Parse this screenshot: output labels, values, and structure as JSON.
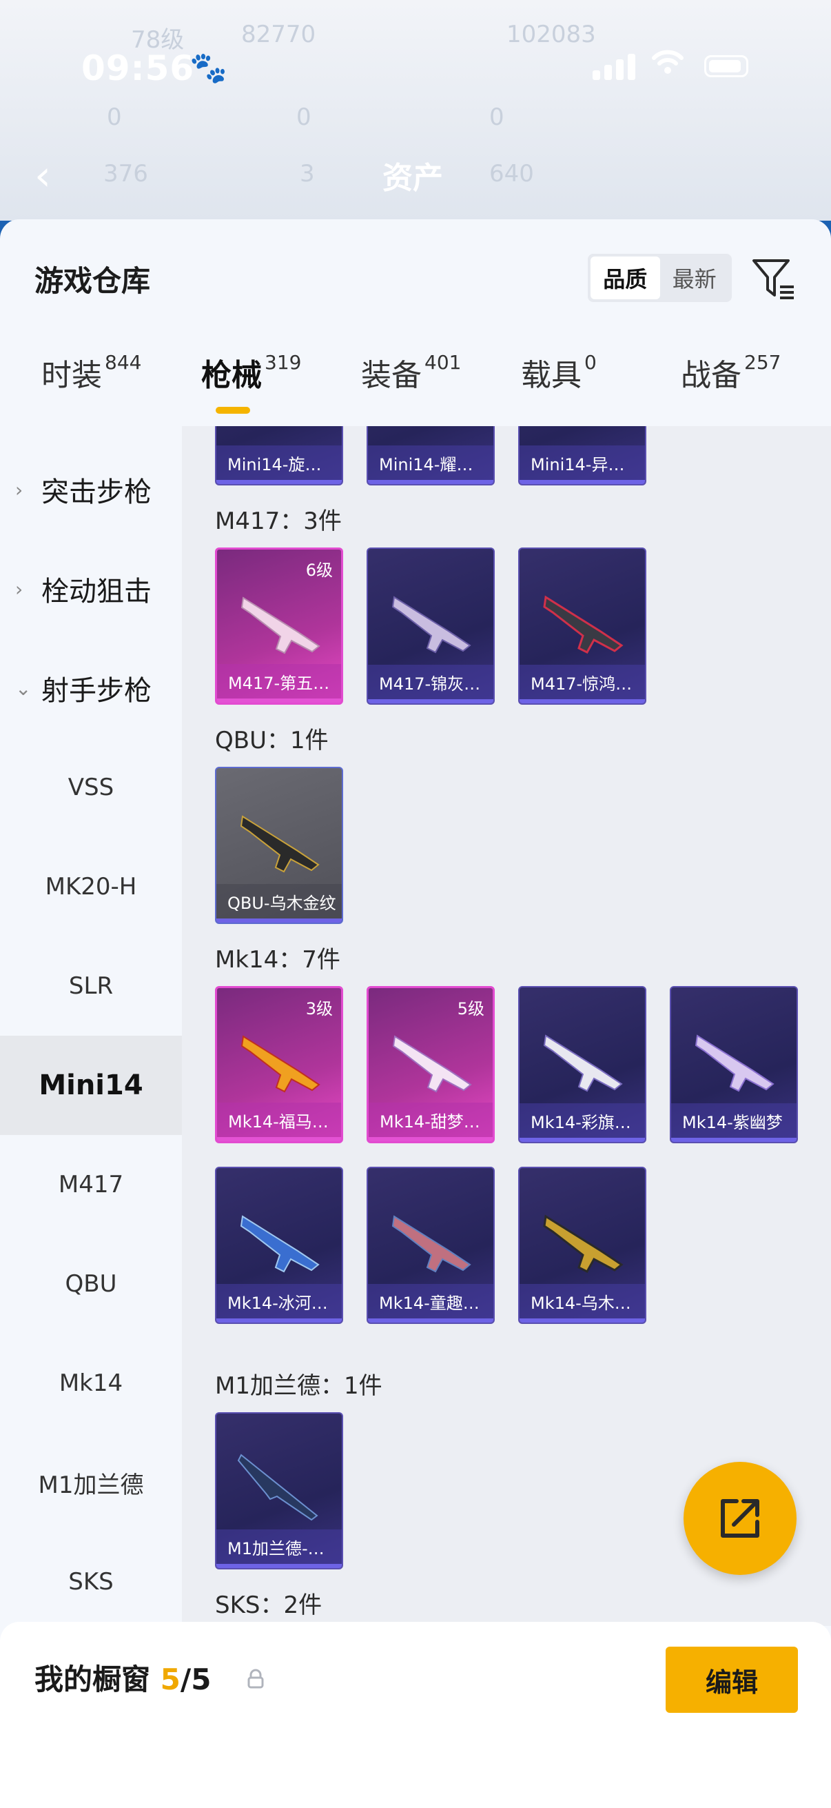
{
  "status": {
    "time": "09:56"
  },
  "background": {
    "title": "资产",
    "faded": [
      "78级",
      "82770",
      "102083",
      "0",
      "0",
      "0",
      "376",
      "3",
      "640"
    ]
  },
  "sheet": {
    "title": "游戏仓库",
    "sort": {
      "options": [
        "品质",
        "最新"
      ],
      "selected": "品质"
    }
  },
  "tabs": [
    {
      "label": "时装",
      "count": "844"
    },
    {
      "label": "枪械",
      "count": "319",
      "active": true
    },
    {
      "label": "装备",
      "count": "401"
    },
    {
      "label": "载具",
      "count": "0"
    },
    {
      "label": "战备",
      "count": "257"
    }
  ],
  "sidebar": {
    "groups": [
      "突击步枪",
      "栓动狙击",
      "射手步枪"
    ],
    "items": [
      "VSS",
      "MK20-H",
      "SLR",
      "Mini14",
      "M417",
      "QBU",
      "Mk14",
      "M1加兰德",
      "SKS"
    ],
    "selected": "Mini14"
  },
  "content": {
    "top_row": [
      "Mini14-旋…",
      "Mini14-耀…",
      "Mini14-异…"
    ],
    "groups": [
      {
        "label": "M417：3件",
        "items": [
          {
            "name": "M417-第五…",
            "level": "6级",
            "rarity": "pink"
          },
          {
            "name": "M417-锦灰…",
            "rarity": "purple"
          },
          {
            "name": "M417-惊鸿…",
            "rarity": "purple"
          }
        ]
      },
      {
        "label": "QBU：1件",
        "items": [
          {
            "name": "QBU-乌木金纹",
            "rarity": "grey"
          }
        ]
      },
      {
        "label": "Mk14：7件",
        "items": [
          {
            "name": "Mk14-福马…",
            "level": "3级",
            "rarity": "pink"
          },
          {
            "name": "Mk14-甜梦…",
            "level": "5级",
            "rarity": "pink"
          },
          {
            "name": "Mk14-彩旗…",
            "rarity": "purple"
          },
          {
            "name": "Mk14-紫幽梦",
            "rarity": "purple"
          },
          {
            "name": "Mk14-冰河…",
            "rarity": "purple"
          },
          {
            "name": "Mk14-童趣…",
            "rarity": "purple"
          },
          {
            "name": "Mk14-乌木…",
            "rarity": "purple"
          }
        ]
      },
      {
        "label": "M1加兰德：1件",
        "items": [
          {
            "name": "M1加兰德-…",
            "rarity": "purple"
          }
        ]
      },
      {
        "label": "SKS：2件",
        "items": []
      }
    ]
  },
  "bottom": {
    "showcase_label": "我的橱窗",
    "showcase_current": "5",
    "showcase_total": "/5",
    "edit_label": "编辑"
  },
  "colors": {
    "accent": "#f6b000",
    "purple_card": "#352f6b",
    "pink_card": "#b0359b"
  }
}
